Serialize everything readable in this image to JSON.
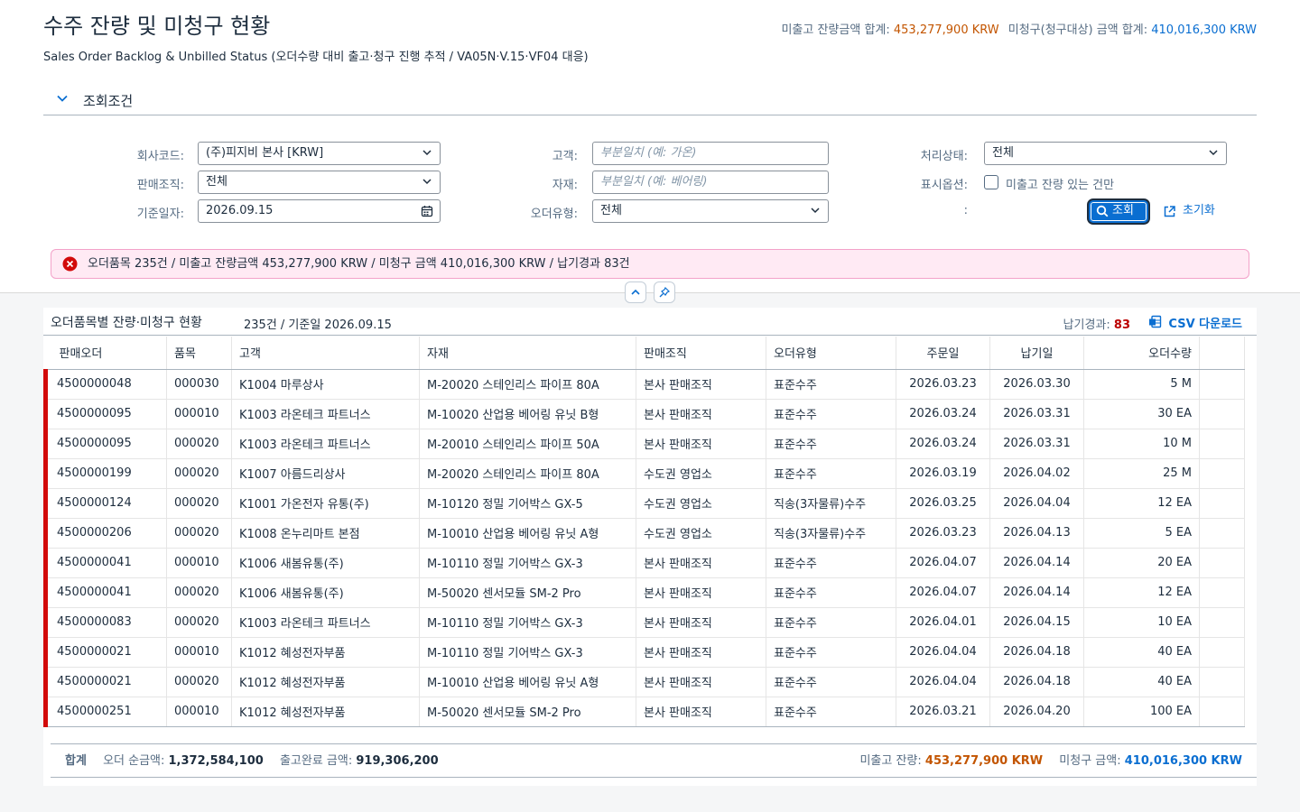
{
  "header": {
    "title": "수주 잔량 및 미청구 현황",
    "subtitle": "Sales Order Backlog & Unbilled Status (오더수량 대비 출고·청구 진행 추적 / VA05N·V.15·VF04 대응)",
    "backlog_label": "미출고 잔량금액 합계:",
    "backlog_value": "453,277,900 KRW",
    "unbilled_label": "미청구(청구대상) 금액 합계:",
    "unbilled_value": "410,016,300 KRW"
  },
  "filter": {
    "title": "조회조건",
    "company_label": "회사코드:",
    "company_value": "(주)피지비 본사 [KRW]",
    "salesorg_label": "판매조직:",
    "salesorg_value": "전체",
    "basedate_label": "기준일자:",
    "basedate_value": "2026.09.15",
    "customer_label": "고객:",
    "customer_placeholder": "부분일치 (예: 가온)",
    "material_label": "자재:",
    "material_placeholder": "부분일치 (예: 베어링)",
    "ordertype_label": "오더유형:",
    "ordertype_value": "전체",
    "status_label": "처리상태:",
    "status_value": "전체",
    "option_label": "표시옵션:",
    "option_checkbox_label": "미출고 잔량 있는 건만",
    "colon": ":",
    "search_label": "조회",
    "reset_label": "초기화"
  },
  "message": {
    "text": "오더품목 235건 / 미출고 잔량금액 453,277,900 KRW / 미청구 금액 410,016,300 KRW / 납기경과 83건"
  },
  "table": {
    "title": "오더품목별 잔량·미청구 현황",
    "count": "235건 / 기준일 2026.09.15",
    "overdue_label": "납기경과:",
    "overdue_value": "83",
    "csv_label": "CSV 다운로드",
    "columns": [
      "판매오더",
      "품목",
      "고객",
      "자재",
      "판매조직",
      "오더유형",
      "주문일",
      "납기일",
      "오더수량"
    ],
    "rows": [
      [
        "4500000048",
        "000030",
        "K1004 마루상사",
        "M-20020 스테인리스 파이프 80A",
        "본사 판매조직",
        "표준수주",
        "2026.03.23",
        "2026.03.30",
        "5 M"
      ],
      [
        "4500000095",
        "000010",
        "K1003 라온테크 파트너스",
        "M-10020 산업용 베어링 유닛 B형",
        "본사 판매조직",
        "표준수주",
        "2026.03.24",
        "2026.03.31",
        "30 EA"
      ],
      [
        "4500000095",
        "000020",
        "K1003 라온테크 파트너스",
        "M-20010 스테인리스 파이프 50A",
        "본사 판매조직",
        "표준수주",
        "2026.03.24",
        "2026.03.31",
        "10 M"
      ],
      [
        "4500000199",
        "000020",
        "K1007 아름드리상사",
        "M-20020 스테인리스 파이프 80A",
        "수도권 영업소",
        "표준수주",
        "2026.03.19",
        "2026.04.02",
        "25 M"
      ],
      [
        "4500000124",
        "000020",
        "K1001 가온전자 유통(주)",
        "M-10120 정밀 기어박스 GX-5",
        "수도권 영업소",
        "직송(3자물류)수주",
        "2026.03.25",
        "2026.04.04",
        "12 EA"
      ],
      [
        "4500000206",
        "000020",
        "K1008 온누리마트 본점",
        "M-10010 산업용 베어링 유닛 A형",
        "수도권 영업소",
        "직송(3자물류)수주",
        "2026.03.23",
        "2026.04.13",
        "5 EA"
      ],
      [
        "4500000041",
        "000010",
        "K1006 새봄유통(주)",
        "M-10110 정밀 기어박스 GX-3",
        "본사 판매조직",
        "표준수주",
        "2026.04.07",
        "2026.04.14",
        "20 EA"
      ],
      [
        "4500000041",
        "000020",
        "K1006 새봄유통(주)",
        "M-50020 센서모듈 SM-2 Pro",
        "본사 판매조직",
        "표준수주",
        "2026.04.07",
        "2026.04.14",
        "12 EA"
      ],
      [
        "4500000083",
        "000020",
        "K1003 라온테크 파트너스",
        "M-10110 정밀 기어박스 GX-3",
        "본사 판매조직",
        "표준수주",
        "2026.04.01",
        "2026.04.15",
        "10 EA"
      ],
      [
        "4500000021",
        "000010",
        "K1012 혜성전자부품",
        "M-10110 정밀 기어박스 GX-3",
        "본사 판매조직",
        "표준수주",
        "2026.04.04",
        "2026.04.18",
        "40 EA"
      ],
      [
        "4500000021",
        "000020",
        "K1012 혜성전자부품",
        "M-10010 산업용 베어링 유닛 A형",
        "본사 판매조직",
        "표준수주",
        "2026.04.04",
        "2026.04.18",
        "40 EA"
      ],
      [
        "4500000251",
        "000010",
        "K1012 혜성전자부품",
        "M-50020 센서모듈 SM-2 Pro",
        "본사 판매조직",
        "표준수주",
        "2026.03.21",
        "2026.04.20",
        "100 EA"
      ]
    ]
  },
  "footer": {
    "total_label": "합계",
    "net_label": "오더 순금액:",
    "net_value": "1,372,584,100",
    "shipped_label": "출고완료 금액:",
    "shipped_value": "919,306,200",
    "backlog_label": "미출고 잔량:",
    "backlog_value": "453,277,900 KRW",
    "unbilled_label": "미청구 금액:",
    "unbilled_value": "410,016,300 KRW"
  },
  "colors": {
    "accent": "#0a6ed1",
    "warning": "#c35500",
    "error": "#d20a0a"
  }
}
